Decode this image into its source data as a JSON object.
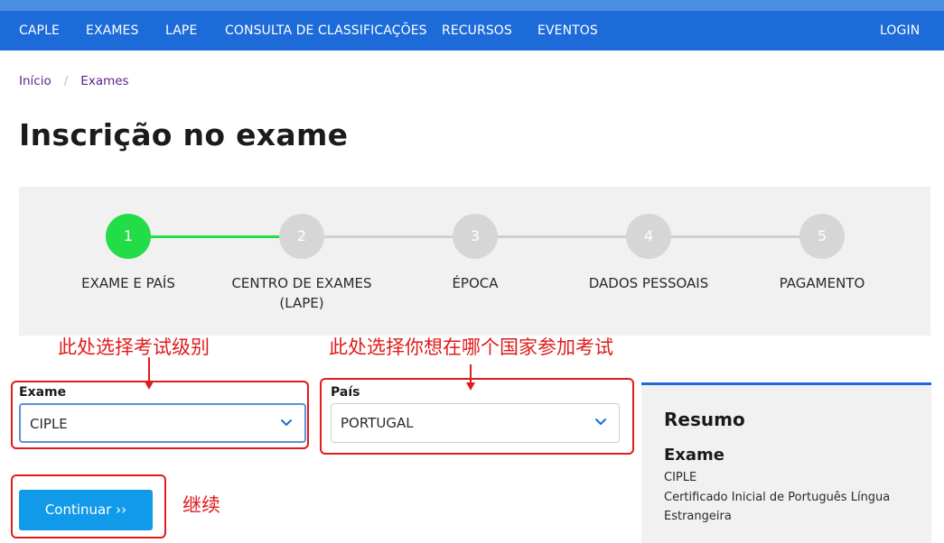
{
  "nav": {
    "items": [
      "CAPLE",
      "EXAMES",
      "LAPE",
      "CONSULTA DE CLASSIFICAÇÕES",
      "RECURSOS",
      "EVENTOS"
    ],
    "login": "LOGIN"
  },
  "breadcrumb": {
    "home": "Início",
    "separator": "/",
    "current": "Exames"
  },
  "page": {
    "title": "Inscrição no exame"
  },
  "steps": [
    {
      "number": "1",
      "label": "EXAME E PAÍS",
      "active": true
    },
    {
      "number": "2",
      "label_line1": "CENTRO DE EXAMES",
      "label_line2": "(LAPE)",
      "active": false
    },
    {
      "number": "3",
      "label": "ÉPOCA",
      "active": false
    },
    {
      "number": "4",
      "label": "DADOS PESSOAIS",
      "active": false
    },
    {
      "number": "5",
      "label": "PAGAMENTO",
      "active": false
    }
  ],
  "annotations": {
    "exam_note": "此处选择考试级别",
    "country_note": "此处选择你想在哪个国家参加考试",
    "continue_note": "继续"
  },
  "form": {
    "exam_label": "Exame",
    "exam_value": "CIPLE",
    "country_label": "País",
    "country_value": "PORTUGAL",
    "continue_label": "Continuar ››"
  },
  "summary": {
    "title": "Resumo",
    "exam_heading": "Exame",
    "exam_code": "CIPLE",
    "exam_name_line1": "Certificado Inicial de Português Língua",
    "exam_name_line2": "Estrangeira"
  },
  "colors": {
    "nav": "#1d6bd9",
    "active_step": "#22dd48",
    "inactive_step": "#d6d6d6",
    "button": "#119ae9",
    "annotation": "#e01b1b"
  },
  "icons": {
    "select_arrow": "chevron-down-icon"
  }
}
